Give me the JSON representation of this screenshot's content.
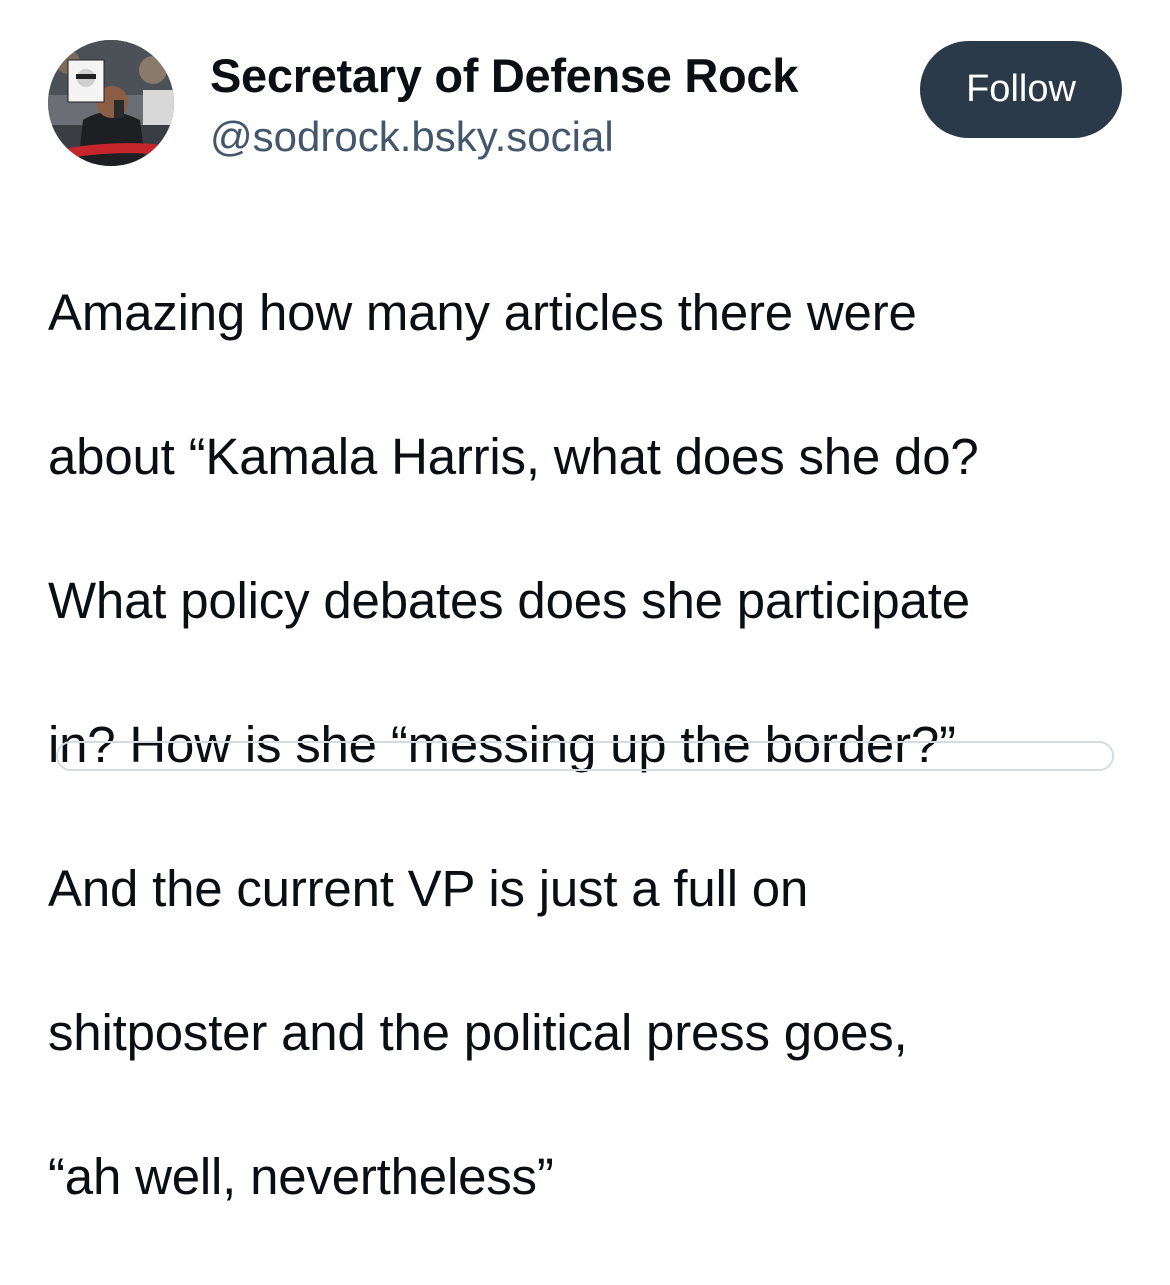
{
  "post": {
    "author": {
      "display_name": "Secretary of Defense Rock",
      "handle": "@sodrock.bsky.social",
      "avatar_icon": "profile-photo"
    },
    "follow_label": "Follow",
    "text_lines": [
      "Amazing how many articles there were",
      "about “Kamala Harris, what does she do?",
      "What policy debates does she participate",
      "in? How is she “messing up the border?”",
      "And the current VP is just a full on",
      "shitposter and the political press goes,",
      "“ah well, nevertheless”"
    ]
  },
  "colors": {
    "follow_button_bg": "#2b3a49",
    "handle_text": "#42576c",
    "body_text": "#0b0f14"
  }
}
